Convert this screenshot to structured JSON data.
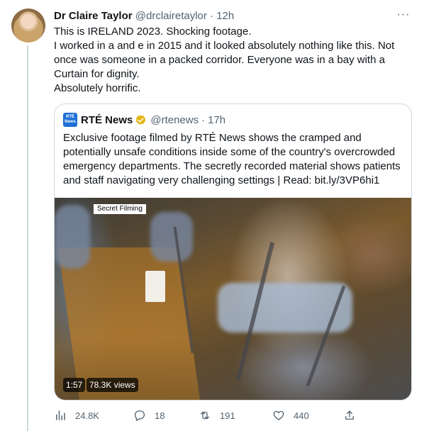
{
  "tweet": {
    "author_name": "Dr Claire Taylor",
    "author_handle": "@drclairetaylor",
    "dot": "·",
    "time": "12h",
    "more": "···",
    "lines": [
      "This is IRELAND 2023. Shocking footage.",
      "I worked in a and e in 2015 and it looked absolutely nothing like this. Not",
      "once was someone in a packed corridor. Everyone was in a bay with a",
      "Curtain for dignity.",
      "Absolutely horrific."
    ]
  },
  "quote": {
    "logo_lines": [
      "RTÉ",
      "News"
    ],
    "name": "RTÉ News",
    "handle": "@rtenews",
    "dot": "·",
    "time": "17h",
    "lines": [
      "Exclusive footage filmed by RTÉ News shows the cramped and",
      "potentially unsafe conditions inside some of the country's overcrowded",
      "emergency departments. The secretly recorded material shows patients",
      "and staff navigating very challenging settings | Read: bit.ly/3VP6hi1"
    ],
    "video": {
      "overlay_label": "Secret Filming",
      "duration": "1:57",
      "views": "78.3K views"
    }
  },
  "actions": {
    "views": "24.8K",
    "replies": "18",
    "retweets": "191",
    "likes": "440"
  },
  "colors": {
    "text": "#0f1419",
    "muted": "#536471",
    "border": "#cfd9de",
    "verified_gold": "#e2b719",
    "rte_blue": "#1d6fd6"
  },
  "icons": [
    "avatar",
    "more-icon",
    "verified-badge-icon",
    "rte-logo",
    "views-icon",
    "reply-icon",
    "retweet-icon",
    "like-icon",
    "share-icon"
  ]
}
